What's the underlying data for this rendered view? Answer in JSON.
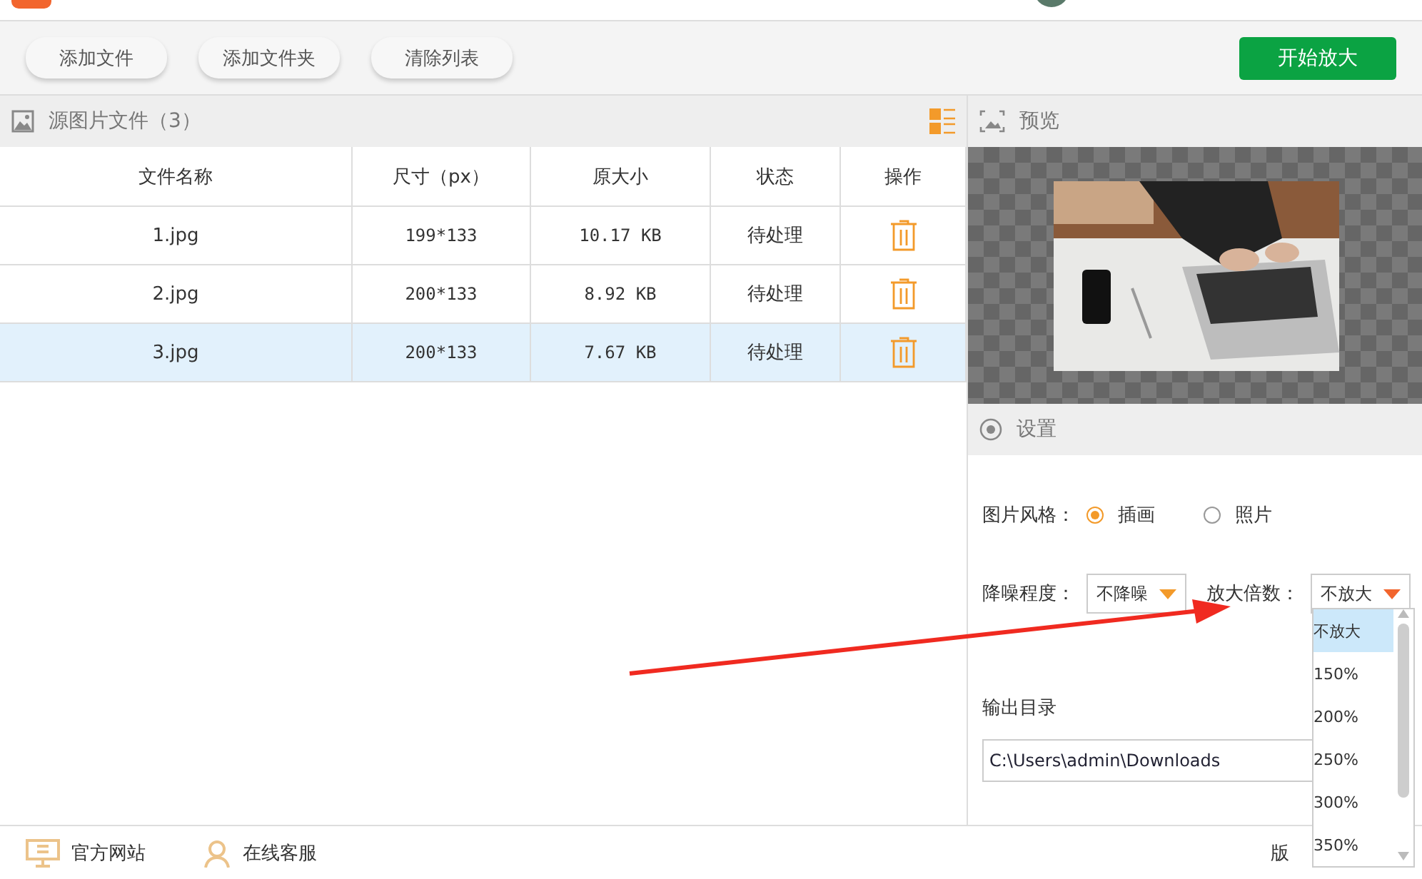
{
  "toolbar": {
    "buttons": [
      "添加文件",
      "添加文件夹",
      "清除列表"
    ],
    "start_button": "开始放大"
  },
  "file_panel": {
    "title": "源图片文件（3）",
    "table": {
      "columns": [
        "文件名称",
        "尺寸（px）",
        "原大小",
        "状态",
        "操作"
      ],
      "rows": [
        {
          "name": "1.jpg",
          "size": "199*133",
          "file_size": "10.17 KB",
          "status": "待处理",
          "selected": false
        },
        {
          "name": "2.jpg",
          "size": "200*133",
          "file_size": "8.92 KB",
          "status": "待处理",
          "selected": false
        },
        {
          "name": "3.jpg",
          "size": "200*133",
          "file_size": "7.67 KB",
          "status": "待处理",
          "selected": true
        }
      ]
    }
  },
  "preview": {
    "title": "预览"
  },
  "settings": {
    "title": "设置",
    "style_label": "图片风格：",
    "style_options": [
      {
        "label": "插画",
        "selected": true
      },
      {
        "label": "照片",
        "selected": false
      }
    ],
    "denoise_label": "降噪程度：",
    "denoise_value": "不降噪",
    "scale_label": "放大倍数：",
    "scale_value": "不放大",
    "scale_options": [
      {
        "label": "不放大",
        "selected": true
      },
      {
        "label": "150%",
        "selected": false
      },
      {
        "label": "200%",
        "selected": false
      },
      {
        "label": "250%",
        "selected": false
      },
      {
        "label": "300%",
        "selected": false
      },
      {
        "label": "350%",
        "selected": false
      }
    ],
    "output_label": "输出目录",
    "output_path": "C:\\Users\\admin\\Downloads"
  },
  "footer": {
    "links": [
      {
        "kind": "website",
        "label": "官方网站"
      },
      {
        "kind": "service",
        "label": "在线客服"
      }
    ],
    "version_text": "版"
  }
}
